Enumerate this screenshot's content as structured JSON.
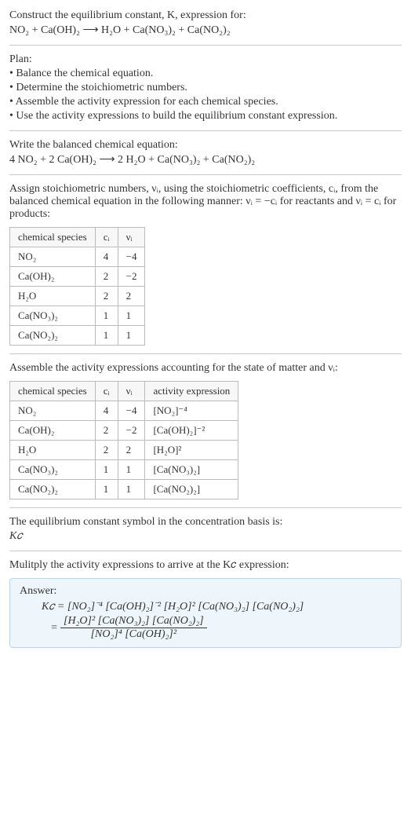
{
  "intro": {
    "line1": "Construct the equilibrium constant, K, expression for:",
    "line2": "NO₂ + Ca(OH)₂  ⟶  H₂O + Ca(NO₃)₂ + Ca(NO₂)₂"
  },
  "plan": {
    "header": "Plan:",
    "items": [
      "• Balance the chemical equation.",
      "• Determine the stoichiometric numbers.",
      "• Assemble the activity expression for each chemical species.",
      "• Use the activity expressions to build the equilibrium constant expression."
    ]
  },
  "balanced": {
    "header": "Write the balanced chemical equation:",
    "eq": "4 NO₂ + 2 Ca(OH)₂  ⟶  2 H₂O + Ca(NO₃)₂ + Ca(NO₂)₂"
  },
  "assign": {
    "text": "Assign stoichiometric numbers, νᵢ, using the stoichiometric coefficients, cᵢ, from the balanced chemical equation in the following manner: νᵢ = −cᵢ for reactants and νᵢ = cᵢ for products:"
  },
  "table1": {
    "headers": [
      "chemical species",
      "cᵢ",
      "νᵢ"
    ],
    "rows": [
      [
        "NO₂",
        "4",
        "−4"
      ],
      [
        "Ca(OH)₂",
        "2",
        "−2"
      ],
      [
        "H₂O",
        "2",
        "2"
      ],
      [
        "Ca(NO₃)₂",
        "1",
        "1"
      ],
      [
        "Ca(NO₂)₂",
        "1",
        "1"
      ]
    ]
  },
  "assemble": {
    "text": "Assemble the activity expressions accounting for the state of matter and νᵢ:"
  },
  "table2": {
    "headers": [
      "chemical species",
      "cᵢ",
      "νᵢ",
      "activity expression"
    ],
    "rows": [
      [
        "NO₂",
        "4",
        "−4",
        "[NO₂]⁻⁴"
      ],
      [
        "Ca(OH)₂",
        "2",
        "−2",
        "[Ca(OH)₂]⁻²"
      ],
      [
        "H₂O",
        "2",
        "2",
        "[H₂O]²"
      ],
      [
        "Ca(NO₃)₂",
        "1",
        "1",
        "[Ca(NO₃)₂]"
      ],
      [
        "Ca(NO₂)₂",
        "1",
        "1",
        "[Ca(NO₂)₂]"
      ]
    ]
  },
  "symbol": {
    "line1": "The equilibrium constant symbol in the concentration basis is:",
    "line2": "K𝑐"
  },
  "multiply": {
    "text": "Mulitply the activity expressions to arrive at the K𝑐 expression:"
  },
  "answer": {
    "label": "Answer:",
    "eq1": "K𝑐 = [NO₂]⁻⁴ [Ca(OH)₂]⁻² [H₂O]² [Ca(NO₃)₂] [Ca(NO₂)₂]",
    "eq2_lhs": "=",
    "eq2_num": "[H₂O]² [Ca(NO₃)₂] [Ca(NO₂)₂]",
    "eq2_den": "[NO₂]⁴ [Ca(OH)₂]²"
  },
  "chart_data": {
    "type": "table",
    "tables": [
      {
        "title": "Stoichiometric numbers",
        "columns": [
          "chemical species",
          "c_i",
          "ν_i"
        ],
        "rows": [
          {
            "chemical species": "NO2",
            "c_i": 4,
            "ν_i": -4
          },
          {
            "chemical species": "Ca(OH)2",
            "c_i": 2,
            "ν_i": -2
          },
          {
            "chemical species": "H2O",
            "c_i": 2,
            "ν_i": 2
          },
          {
            "chemical species": "Ca(NO3)2",
            "c_i": 1,
            "ν_i": 1
          },
          {
            "chemical species": "Ca(NO2)2",
            "c_i": 1,
            "ν_i": 1
          }
        ]
      },
      {
        "title": "Activity expressions",
        "columns": [
          "chemical species",
          "c_i",
          "ν_i",
          "activity expression"
        ],
        "rows": [
          {
            "chemical species": "NO2",
            "c_i": 4,
            "ν_i": -4,
            "activity expression": "[NO2]^-4"
          },
          {
            "chemical species": "Ca(OH)2",
            "c_i": 2,
            "ν_i": -2,
            "activity expression": "[Ca(OH)2]^-2"
          },
          {
            "chemical species": "H2O",
            "c_i": 2,
            "ν_i": 2,
            "activity expression": "[H2O]^2"
          },
          {
            "chemical species": "Ca(NO3)2",
            "c_i": 1,
            "ν_i": 1,
            "activity expression": "[Ca(NO3)2]"
          },
          {
            "chemical species": "Ca(NO2)2",
            "c_i": 1,
            "ν_i": 1,
            "activity expression": "[Ca(NO2)2]"
          }
        ]
      }
    ]
  }
}
